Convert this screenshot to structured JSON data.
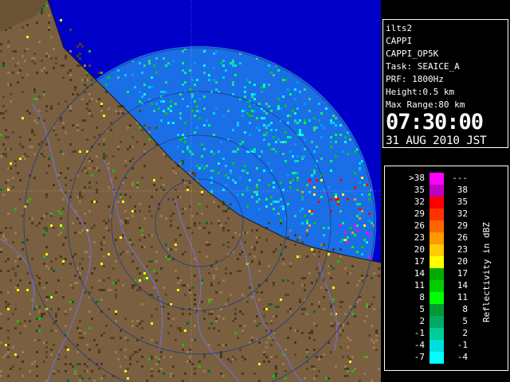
{
  "info": {
    "radar_name": "ilts2",
    "product": "CAPPI",
    "product_id": "CAPPI_OP5K",
    "task": "Task: SEAICE_A",
    "prf": "PRF: 1800Hz",
    "height": "Height:0.5 km",
    "max_range": "Max Range:80 km",
    "time": "07:30:00",
    "date": "31 AUG 2010 JST"
  },
  "legend": {
    "unit_label": "Reflectivity in dBZ",
    "bins": [
      {
        "low": ">38",
        "high": "---",
        "color": "#ff00ff"
      },
      {
        "low": "35",
        "high": "38",
        "color": "#bf00bf"
      },
      {
        "low": "32",
        "high": "35",
        "color": "#ff0000"
      },
      {
        "low": "29",
        "high": "32",
        "color": "#ff3300"
      },
      {
        "low": "26",
        "high": "29",
        "color": "#ff6600"
      },
      {
        "low": "23",
        "high": "26",
        "color": "#ff9900"
      },
      {
        "low": "20",
        "high": "23",
        "color": "#ffcc00"
      },
      {
        "low": "17",
        "high": "20",
        "color": "#ffff00"
      },
      {
        "low": "14",
        "high": "17",
        "color": "#00aa00"
      },
      {
        "low": "11",
        "high": "14",
        "color": "#00cc00"
      },
      {
        "low": "8",
        "high": "11",
        "color": "#00ff00"
      },
      {
        "low": "5",
        "high": "8",
        "color": "#009933"
      },
      {
        "low": "2",
        "high": "5",
        "color": "#00aa66"
      },
      {
        "low": "-1",
        "high": "2",
        "color": "#00cc99"
      },
      {
        "low": "-4",
        "high": "-1",
        "color": "#00dddd"
      },
      {
        "low": "-7",
        "high": "-4",
        "color": "#00ffff"
      }
    ]
  },
  "map": {
    "sea_color": "#1a6fe6",
    "range_circle_color": "#2b5ab8",
    "land_color": "#7a6040",
    "river_color": "#7070d0",
    "grid_color": "#ffffff"
  }
}
